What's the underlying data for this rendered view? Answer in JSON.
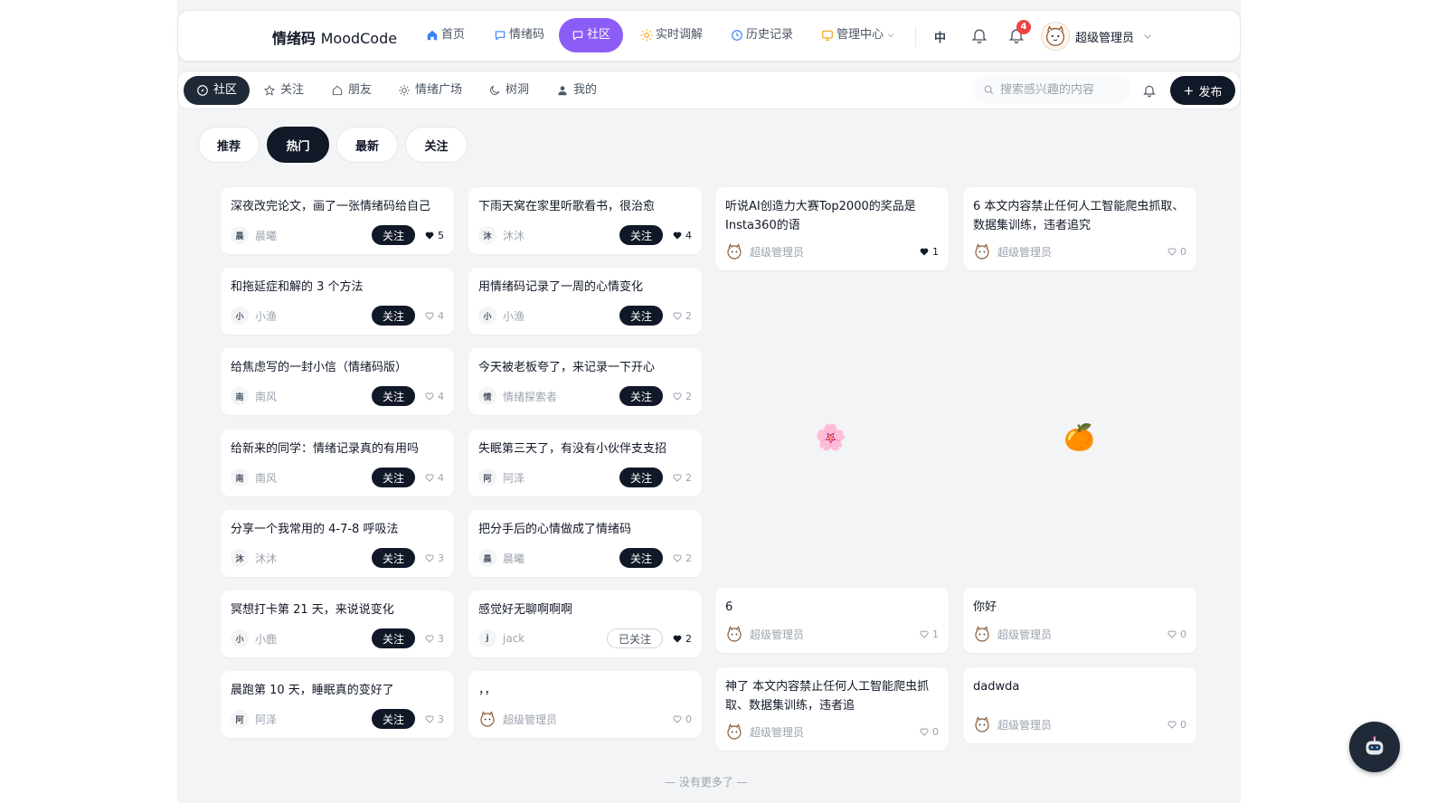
{
  "brand": {
    "name": "情绪码",
    "en": "MoodCode"
  },
  "nav": [
    {
      "label": "首页",
      "icon": "home-icon",
      "active": false
    },
    {
      "label": "情绪码",
      "icon": "chat-icon",
      "active": false
    },
    {
      "label": "社区",
      "icon": "community-icon",
      "active": true
    },
    {
      "label": "实时调解",
      "icon": "sun-icon",
      "active": false
    },
    {
      "label": "历史记录",
      "icon": "clock-icon",
      "active": false
    },
    {
      "label": "管理中心",
      "icon": "admin-icon",
      "active": false
    }
  ],
  "header": {
    "lang": "中",
    "notif_count": "4",
    "user": "超级管理员"
  },
  "subnav": [
    {
      "label": "社区",
      "icon": "compass-icon",
      "active": true
    },
    {
      "label": "关注",
      "icon": "star-icon",
      "active": false
    },
    {
      "label": "朋友",
      "icon": "house-icon",
      "active": false
    },
    {
      "label": "情绪广场",
      "icon": "sun-icon",
      "active": false
    },
    {
      "label": "树洞",
      "icon": "moon-icon",
      "active": false
    },
    {
      "label": "我的",
      "icon": "user-icon",
      "active": false
    }
  ],
  "search": {
    "placeholder": "搜索感兴趣的内容"
  },
  "publish_label": "发布",
  "filters": [
    {
      "label": "推荐",
      "active": false
    },
    {
      "label": "热门",
      "active": true
    },
    {
      "label": "最新",
      "active": false
    },
    {
      "label": "关注",
      "active": false
    }
  ],
  "columns": [
    [
      {
        "title": "深夜改完论文，画了一张情绪码给自己",
        "avatar": "晨",
        "author": "晨曦",
        "follow": "关注",
        "following": false,
        "likes": "5",
        "liked": true
      },
      {
        "title": "和拖延症和解的 3 个方法",
        "avatar": "小",
        "author": "小渔",
        "follow": "关注",
        "following": false,
        "likes": "4",
        "liked": false
      },
      {
        "title": "给焦虑写的一封小信（情绪码版）",
        "avatar": "南",
        "author": "南风",
        "follow": "关注",
        "following": false,
        "likes": "4",
        "liked": false
      },
      {
        "title": "给新来的同学：情绪记录真的有用吗",
        "avatar": "南",
        "author": "南风",
        "follow": "关注",
        "following": false,
        "likes": "4",
        "liked": false
      },
      {
        "title": "分享一个我常用的 4-7-8 呼吸法",
        "avatar": "沐",
        "author": "沐沐",
        "follow": "关注",
        "following": false,
        "likes": "3",
        "liked": false
      },
      {
        "title": "冥想打卡第 21 天，来说说变化",
        "avatar": "小",
        "author": "小鹿",
        "follow": "关注",
        "following": false,
        "likes": "3",
        "liked": false
      },
      {
        "title": "晨跑第 10 天，睡眠真的变好了",
        "avatar": "阿",
        "author": "阿泽",
        "follow": "关注",
        "following": false,
        "likes": "3",
        "liked": false
      }
    ],
    [
      {
        "title": "下雨天窝在家里听歌看书，很治愈",
        "avatar": "沐",
        "author": "沐沐",
        "follow": "关注",
        "following": false,
        "likes": "4",
        "liked": true
      },
      {
        "title": "用情绪码记录了一周的心情变化",
        "avatar": "小",
        "author": "小渔",
        "follow": "关注",
        "following": false,
        "likes": "2",
        "liked": false
      },
      {
        "title": "今天被老板夸了，来记录一下开心",
        "avatar": "情",
        "author": "情绪探索者",
        "follow": "关注",
        "following": false,
        "likes": "2",
        "liked": false
      },
      {
        "title": "失眠第三天了，有没有小伙伴支支招",
        "avatar": "阿",
        "author": "阿泽",
        "follow": "关注",
        "following": false,
        "likes": "2",
        "liked": false
      },
      {
        "title": "把分手后的心情做成了情绪码",
        "avatar": "晨",
        "author": "晨曦",
        "follow": "关注",
        "following": false,
        "likes": "2",
        "liked": false
      },
      {
        "title": "感觉好无聊啊啊啊",
        "avatar": "j",
        "author": "jack",
        "follow": "已关注",
        "following": true,
        "likes": "2",
        "liked": true
      },
      {
        "title": "，，",
        "avatar": "",
        "author": "超级管理员",
        "follow": "",
        "following": false,
        "likes": "0",
        "liked": false,
        "admin": true
      }
    ],
    [
      {
        "title": "听说AI创造力大赛Top2000的奖品是Insta360的语",
        "author": "超级管理员",
        "likes": "1",
        "liked": true,
        "admin": true
      },
      {
        "title": "",
        "author": "",
        "likes": "",
        "image": "cherry-blossom-icon"
      },
      {
        "title": "6",
        "author": "超级管理员",
        "likes": "1",
        "liked": false,
        "admin": true
      },
      {
        "title": "神了 本文内容禁止任何人工智能爬虫抓取、数据集训练，违者追",
        "author": "超级管理员",
        "likes": "0",
        "liked": false,
        "admin": true
      }
    ],
    [
      {
        "title": "6 本文内容禁止任何人工智能爬虫抓取、数据集训练，违者追究",
        "author": "超级管理员",
        "likes": "0",
        "liked": false,
        "admin": true
      },
      {
        "title": "",
        "author": "",
        "likes": "",
        "image": "tangerine-icon"
      },
      {
        "title": "你好",
        "author": "超级管理员",
        "likes": "0",
        "liked": false,
        "admin": true
      },
      {
        "title": "dadwda",
        "author": "超级管理员",
        "likes": "0",
        "liked": false,
        "admin": true
      }
    ]
  ],
  "deco": {
    "blossom": "🌸",
    "tangerine": "🍊"
  },
  "end_text": "— 没有更多了 —"
}
